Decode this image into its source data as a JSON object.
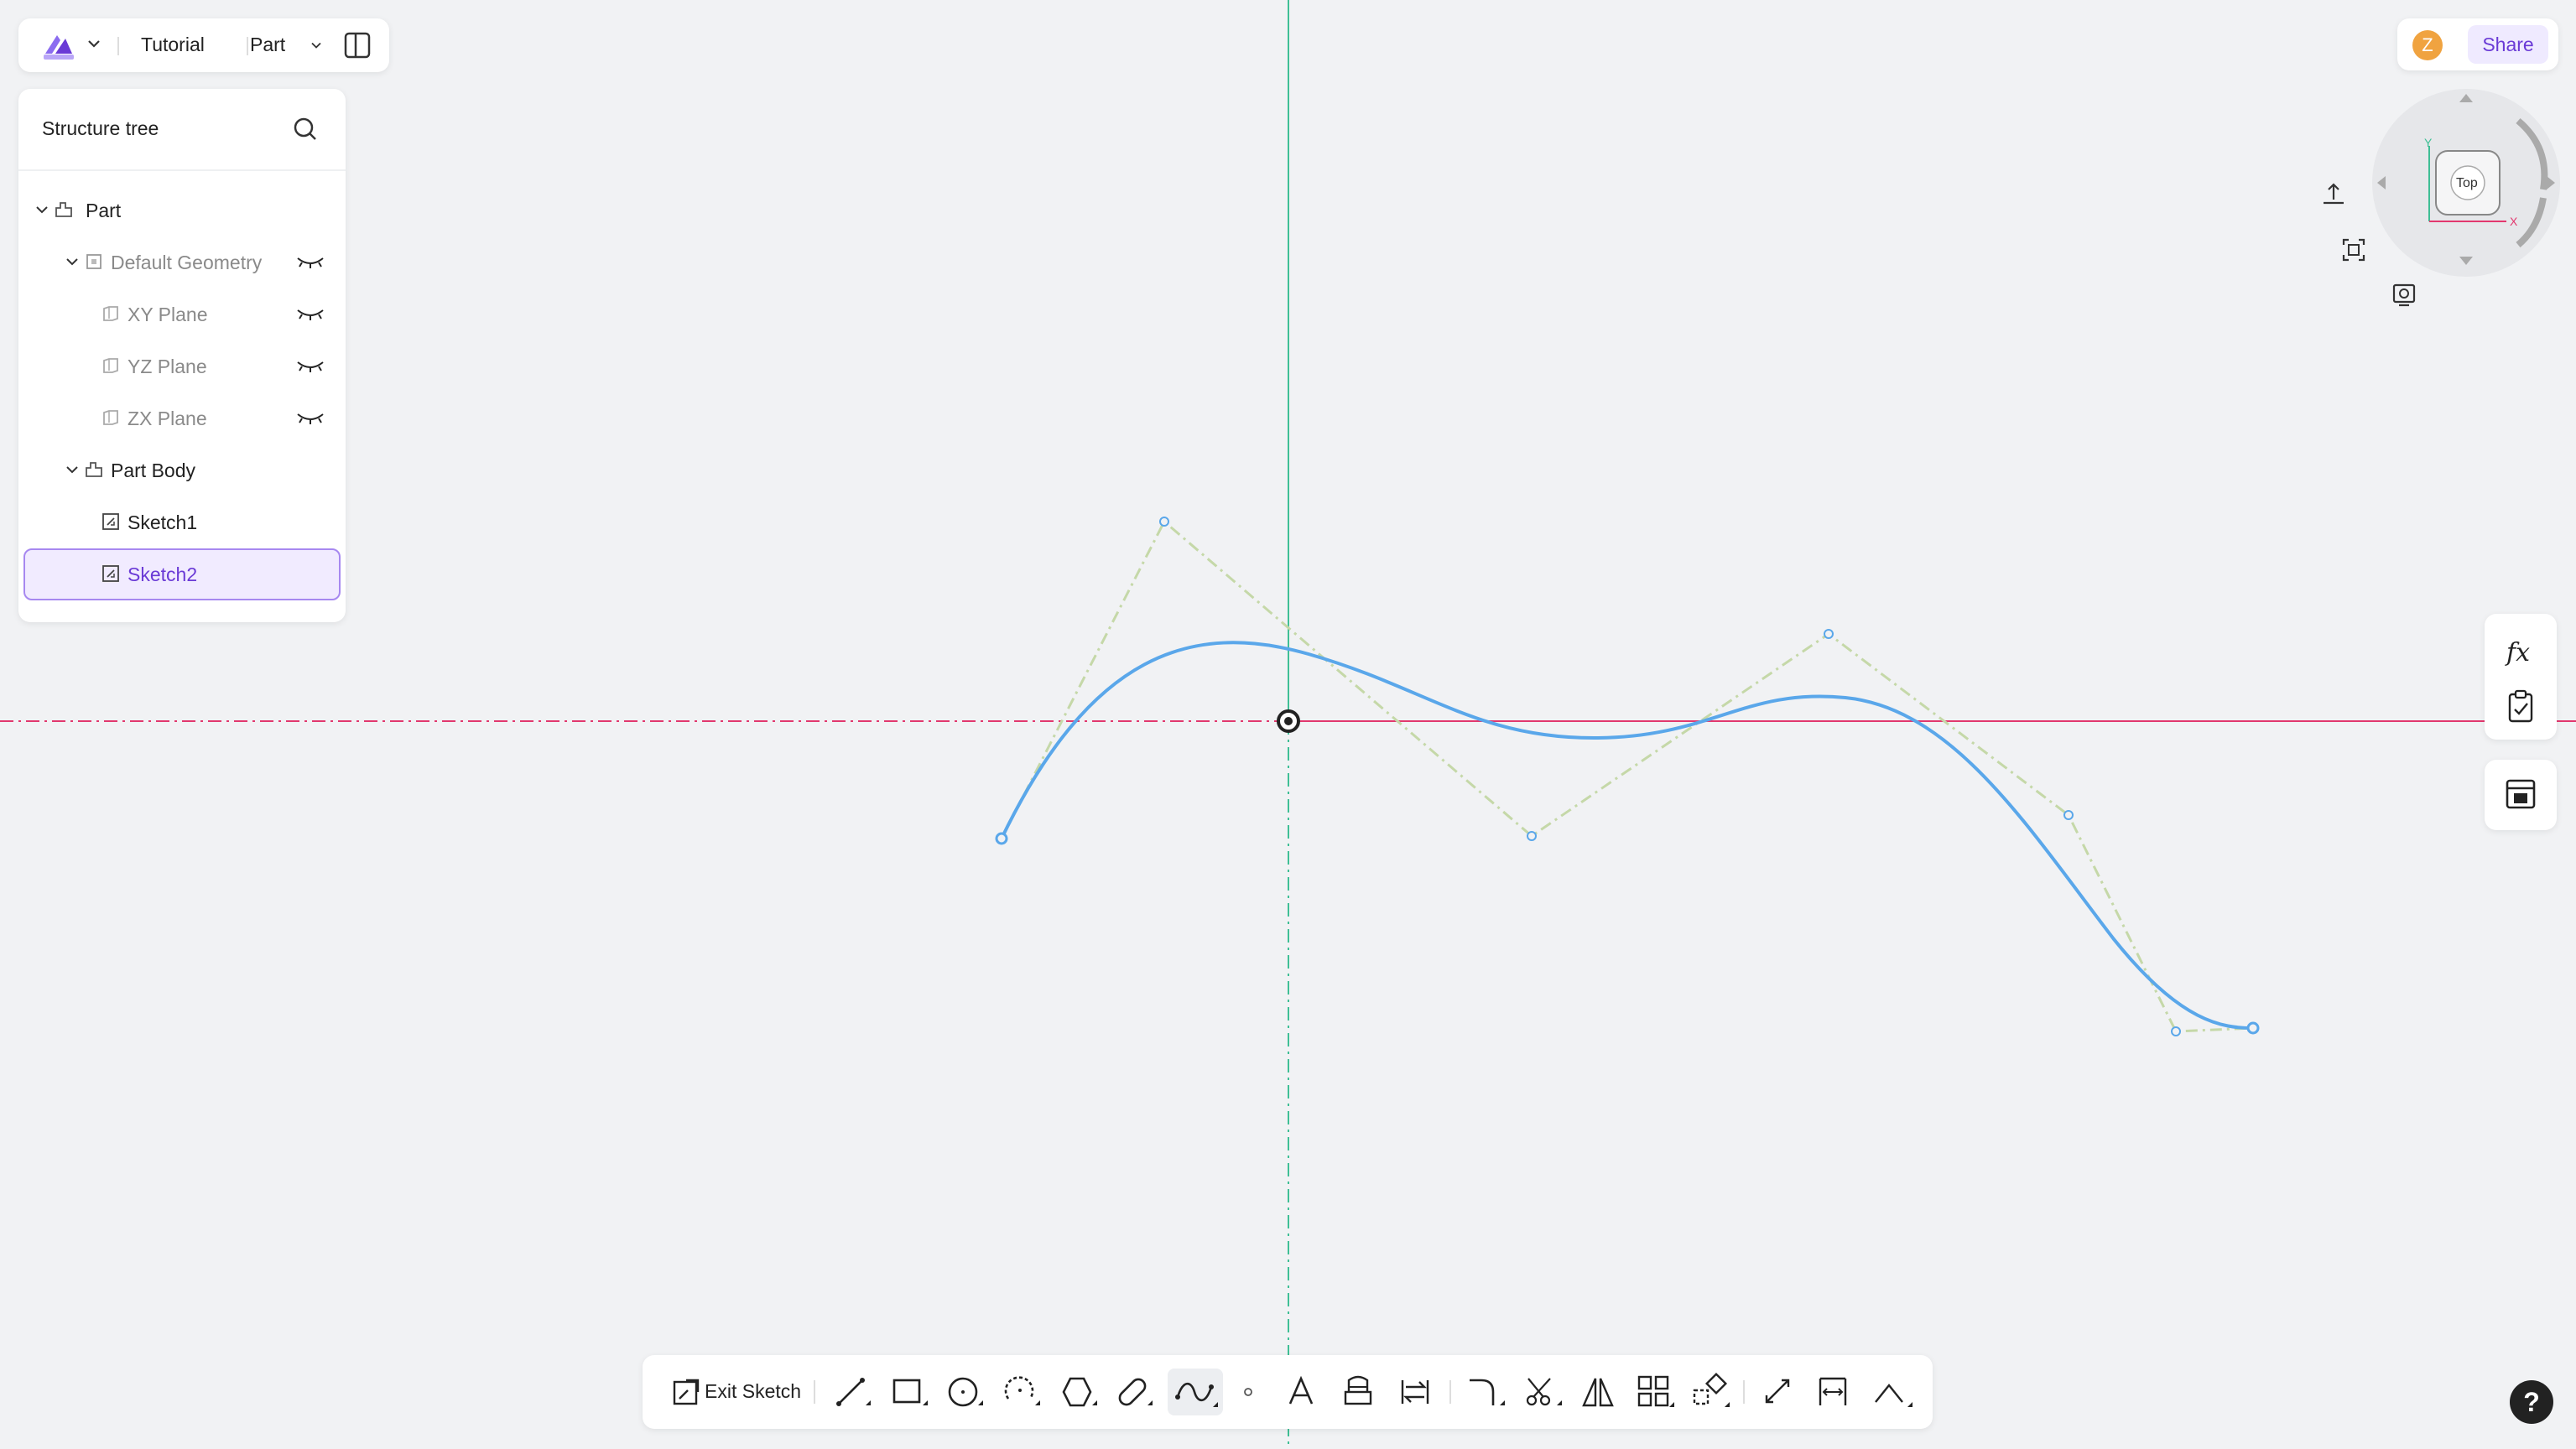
{
  "topbar": {
    "project": "Tutorial",
    "mode": "Part"
  },
  "tree": {
    "header": "Structure tree",
    "items": [
      {
        "label": "Part"
      },
      {
        "label": "Default Geometry"
      },
      {
        "label": "XY Plane"
      },
      {
        "label": "YZ Plane"
      },
      {
        "label": "ZX Plane"
      },
      {
        "label": "Part Body"
      },
      {
        "label": "Sketch1"
      },
      {
        "label": "Sketch2"
      }
    ]
  },
  "user": {
    "avatar_initial": "Z",
    "share_label": "Share"
  },
  "navcube": {
    "face_label": "Top",
    "axis_x": "X",
    "axis_y": "Y"
  },
  "toolbar": {
    "exit_label": "Exit Sketch"
  },
  "help": {
    "label": "?"
  },
  "colors": {
    "accent": "#6a3ad6",
    "spline": "#5aa7ea",
    "axis_h": "#e2386e",
    "axis_v": "#3fbf95",
    "control_polygon": "#c5d8a8"
  }
}
